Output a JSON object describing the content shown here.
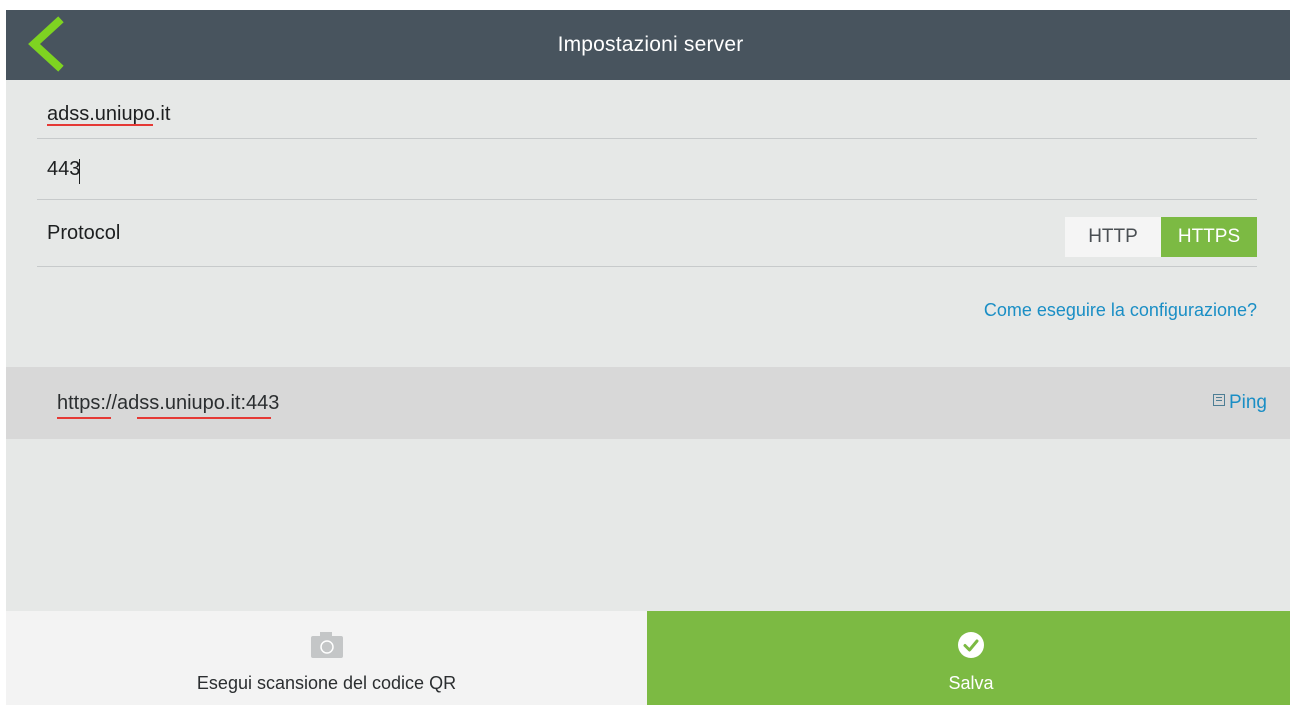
{
  "header": {
    "title": "Impostazioni server",
    "back_icon": "chevron-left-icon"
  },
  "form": {
    "host_value": "adss.uniupo.it",
    "port_value": "443",
    "protocol_label": "Protocol",
    "protocol_options": [
      "HTTP",
      "HTTPS"
    ],
    "protocol_selected": "HTTPS"
  },
  "help_link": "Come eseguire la configurazione?",
  "url_preview": {
    "url": "https://adss.uniupo.it:443",
    "ping_label": "Ping",
    "ping_icon": "ping-icon"
  },
  "footer": {
    "scan_label": "Esegui scansione del codice QR",
    "scan_icon": "camera-icon",
    "save_label": "Salva",
    "save_icon": "check-circle-icon"
  },
  "colors": {
    "header_bg": "#48545e",
    "accent_green": "#7cba43",
    "link_blue": "#1a8ec5",
    "background": "#e6e8e7"
  }
}
